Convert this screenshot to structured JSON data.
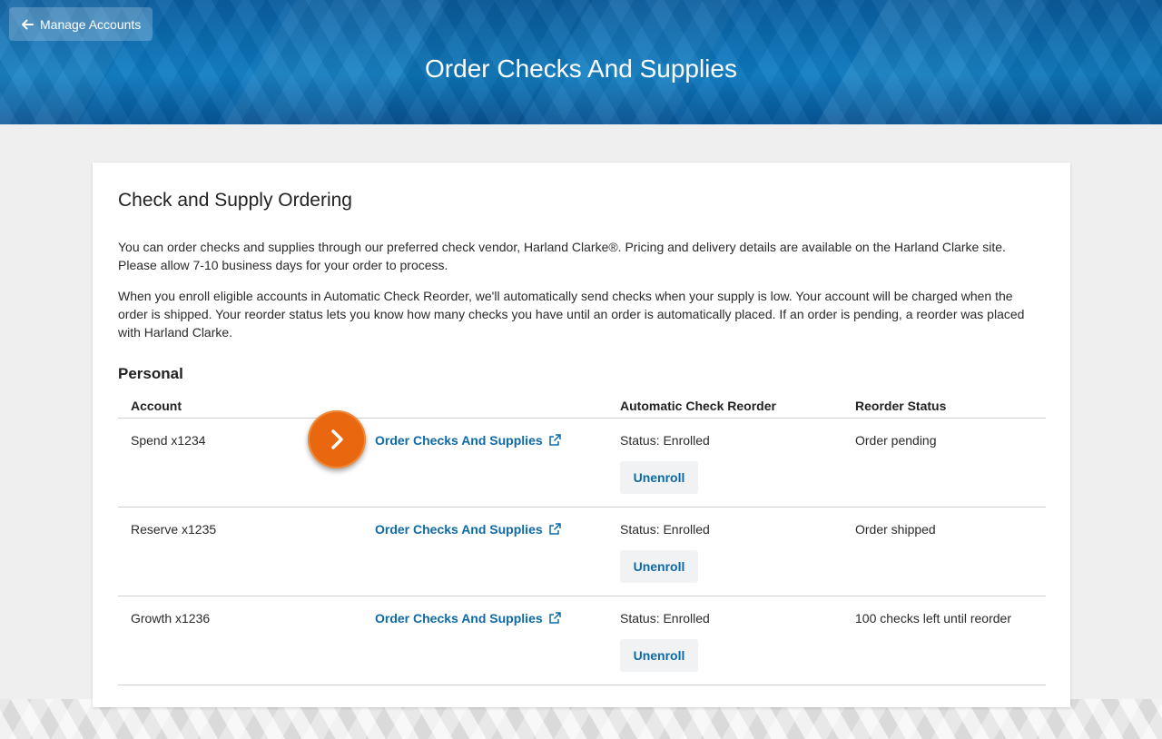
{
  "header": {
    "back_label": "Manage Accounts",
    "title": "Order Checks And Supplies"
  },
  "card": {
    "title": "Check and Supply Ordering",
    "paragraph1": "You can order checks and supplies through our preferred check vendor, Harland Clarke®. Pricing and delivery details are available on the Harland Clarke site. Please allow 7-10 business days for your order to process.",
    "paragraph2": "When you enroll eligible accounts in Automatic Check Reorder, we'll automatically send checks when your supply is low. Your account will be charged when the order is shipped. Your reorder status lets you know how many checks you have until an order is automatically placed. If an order is pending, a reorder was placed with Harland Clarke.",
    "section_title": "Personal"
  },
  "table": {
    "headers": {
      "account": "Account",
      "auto_reorder": "Automatic Check Reorder",
      "reorder_status": "Reorder Status"
    },
    "rows": [
      {
        "account": "Spend x1234",
        "link": "Order Checks And Supplies",
        "status": "Status: Enrolled",
        "button": "Unenroll",
        "reorder": "Order pending"
      },
      {
        "account": "Reserve x1235",
        "link": "Order Checks And Supplies",
        "status": "Status: Enrolled",
        "button": "Unenroll",
        "reorder": "Order shipped"
      },
      {
        "account": "Growth x1236",
        "link": "Order Checks And Supplies",
        "status": "Status: Enrolled",
        "button": "Unenroll",
        "reorder": "100 checks left until reorder"
      }
    ]
  },
  "icons": {
    "back": "arrow-left-icon",
    "external": "external-link-icon",
    "hint": "chevron-right-icon"
  },
  "colors": {
    "link": "#0d6aa8",
    "hint": "#e9670f",
    "header": "#0b73b8"
  }
}
